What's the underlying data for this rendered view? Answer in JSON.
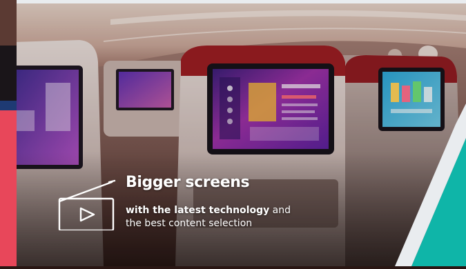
{
  "caption": {
    "headline": "Bigger screens",
    "subline_bold": "with the latest technology",
    "subline_rest_1": " and",
    "subline_rest_2": "the best content selection"
  },
  "icons": {
    "caption_icon": "tv-play-icon"
  },
  "colors": {
    "accent_red": "#e8475a",
    "accent_navy": "#1e3a73",
    "accent_teal": "#0fb5a8",
    "seat_red": "#9a1c22",
    "text": "#ffffff"
  }
}
